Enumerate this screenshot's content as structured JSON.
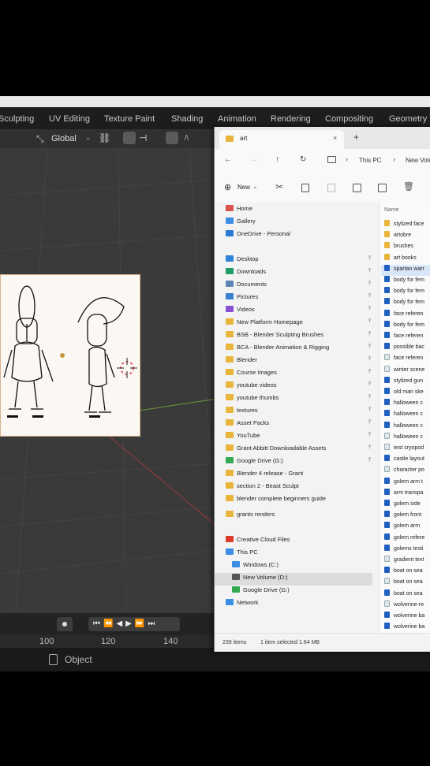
{
  "blender": {
    "workspace_tabs": [
      "Sculpting",
      "UV Editing",
      "Texture Paint",
      "Shading",
      "Animation",
      "Rendering",
      "Compositing",
      "Geometry"
    ],
    "transform_orientation": "Global",
    "timeline_frames": [
      "100",
      "120",
      "140"
    ],
    "status_mode": "Object"
  },
  "explorer": {
    "tab_title": "art",
    "breadcrumb": [
      "This PC",
      "New Volu"
    ],
    "new_label": "New",
    "column_header": "Name",
    "nav_items": [
      {
        "label": "Home",
        "icon": "home-icon",
        "color": "#d9534f",
        "pinned": false
      },
      {
        "label": "Gallery",
        "icon": "gallery-icon",
        "color": "#3a8ee6",
        "pinned": false
      },
      {
        "label": "OneDrive - Personal",
        "icon": "cloud-icon",
        "color": "#2a7ad4",
        "pinned": false
      },
      {
        "label": "Desktop",
        "icon": "desktop-icon",
        "color": "#2f83d6",
        "pinned": true
      },
      {
        "label": "Downloads",
        "icon": "download-icon",
        "color": "#1e9e63",
        "pinned": true
      },
      {
        "label": "Documents",
        "icon": "document-icon",
        "color": "#5c86b8",
        "pinned": true
      },
      {
        "label": "Pictures",
        "icon": "pictures-icon",
        "color": "#3a7fd1",
        "pinned": true
      },
      {
        "label": "Videos",
        "icon": "videos-icon",
        "color": "#8a4ed2",
        "pinned": true
      },
      {
        "label": "New Platform Homepage",
        "icon": "folder-icon",
        "color": "#e8b43a",
        "pinned": true
      },
      {
        "label": "BSB - Blender Sculpting Brushes",
        "icon": "folder-icon",
        "color": "#e8b43a",
        "pinned": true
      },
      {
        "label": "BCA - Blender Animation & Rigging",
        "icon": "folder-icon",
        "color": "#e8b43a",
        "pinned": true
      },
      {
        "label": "Blender",
        "icon": "folder-icon",
        "color": "#e8b43a",
        "pinned": true
      },
      {
        "label": "Course Images",
        "icon": "folder-icon",
        "color": "#e8b43a",
        "pinned": true
      },
      {
        "label": "youtube videos",
        "icon": "folder-icon",
        "color": "#e8b43a",
        "pinned": true
      },
      {
        "label": "youtube thumbs",
        "icon": "folder-icon",
        "color": "#e8b43a",
        "pinned": true
      },
      {
        "label": "textures",
        "icon": "folder-icon",
        "color": "#e8b43a",
        "pinned": true
      },
      {
        "label": "Asset Packs",
        "icon": "folder-icon",
        "color": "#e8b43a",
        "pinned": true
      },
      {
        "label": "YouTube",
        "icon": "folder-icon",
        "color": "#e8b43a",
        "pinned": true
      },
      {
        "label": "Grant Abbitt Downloadable Assets",
        "icon": "folder-icon",
        "color": "#e8b43a",
        "pinned": true
      },
      {
        "label": "Google Drive (G:)",
        "icon": "google-drive-icon",
        "color": "#34a853",
        "pinned": true
      },
      {
        "label": "Blender 4 release - Grant",
        "icon": "folder-icon",
        "color": "#e8b43a",
        "pinned": false
      },
      {
        "label": "section 2 - Beast Sculpt",
        "icon": "folder-icon",
        "color": "#e8b43a",
        "pinned": false
      },
      {
        "label": "blender complete beginners guide",
        "icon": "folder-icon",
        "color": "#e8b43a",
        "pinned": false
      },
      {
        "label": "grants renders",
        "icon": "folder-icon",
        "color": "#e8b43a",
        "pinned": false
      },
      {
        "label": "Creative Cloud Files",
        "icon": "creative-cloud-icon",
        "color": "#da3b2b",
        "pinned": false
      },
      {
        "label": "This PC",
        "icon": "pc-icon",
        "color": "#3a8ee6",
        "pinned": false
      },
      {
        "label": "Windows (C:)",
        "icon": "drive-icon",
        "color": "#3a8ee6",
        "pinned": false
      },
      {
        "label": "New Volume (D:)",
        "icon": "drive-icon",
        "color": "#555555",
        "pinned": false
      },
      {
        "label": "Google Drive (G:)",
        "icon": "google-drive-icon",
        "color": "#34a853",
        "pinned": false
      },
      {
        "label": "Network",
        "icon": "network-icon",
        "color": "#3a8ee6",
        "pinned": false
      }
    ],
    "files": [
      {
        "name": "stylized face",
        "type": "folder"
      },
      {
        "name": "artobre",
        "type": "folder"
      },
      {
        "name": "brushes",
        "type": "folder"
      },
      {
        "name": "art books",
        "type": "folder"
      },
      {
        "name": "spartan warr",
        "type": "doc"
      },
      {
        "name": "body for fem",
        "type": "doc"
      },
      {
        "name": "body for fem",
        "type": "doc"
      },
      {
        "name": "body for fem",
        "type": "doc"
      },
      {
        "name": "face referen",
        "type": "doc"
      },
      {
        "name": "body for fem",
        "type": "doc"
      },
      {
        "name": "face referen",
        "type": "doc"
      },
      {
        "name": "possible bac",
        "type": "doc"
      },
      {
        "name": "face referen",
        "type": "img"
      },
      {
        "name": "winter scene",
        "type": "img"
      },
      {
        "name": "stylized gun",
        "type": "doc"
      },
      {
        "name": "old man ske",
        "type": "doc"
      },
      {
        "name": "halloween c",
        "type": "doc"
      },
      {
        "name": "halloween c",
        "type": "doc"
      },
      {
        "name": "halloween c",
        "type": "doc"
      },
      {
        "name": "halloween c",
        "type": "img"
      },
      {
        "name": "test cryopod",
        "type": "img"
      },
      {
        "name": "castle layout",
        "type": "doc"
      },
      {
        "name": "character po",
        "type": "img"
      },
      {
        "name": "golem arm t",
        "type": "doc"
      },
      {
        "name": "arm transpa",
        "type": "doc"
      },
      {
        "name": "golem side",
        "type": "doc"
      },
      {
        "name": "golem front",
        "type": "doc"
      },
      {
        "name": "golem arm",
        "type": "doc"
      },
      {
        "name": "golem refere",
        "type": "doc"
      },
      {
        "name": "golems testi",
        "type": "doc"
      },
      {
        "name": "gradient text",
        "type": "img"
      },
      {
        "name": "boat on sea",
        "type": "doc"
      },
      {
        "name": "boat on sea",
        "type": "img"
      },
      {
        "name": "boat on sea",
        "type": "doc"
      },
      {
        "name": "wolverine-re",
        "type": "img"
      },
      {
        "name": "wolverine ba",
        "type": "doc"
      },
      {
        "name": "wolverine ba",
        "type": "doc"
      }
    ],
    "status_count": "239 items",
    "status_selected": "1 item selected  1.64 MB"
  }
}
